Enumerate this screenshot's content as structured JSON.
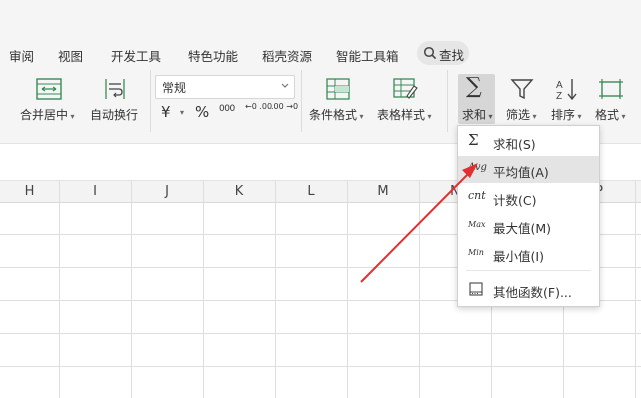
{
  "menubar": {
    "items": [
      "审阅",
      "视图",
      "开发工具",
      "特色功能",
      "稻壳资源",
      "智能工具箱"
    ],
    "search_label": "查找"
  },
  "ribbon": {
    "merge_label": "合并居中",
    "wrap_label": "自动换行",
    "number_format_value": "常规",
    "currency_symbol": "¥",
    "percent_symbol": "%",
    "thousands_symbol": "000",
    "decrease_decimal": "←0 .00",
    "increase_decimal": ".00 →0",
    "cond_format_label": "条件格式",
    "table_style_label": "表格样式",
    "sum_label": "求和",
    "filter_label": "筛选",
    "sort_label": "排序",
    "format_label": "格式"
  },
  "columns": [
    "H",
    "I",
    "J",
    "K",
    "L",
    "M",
    "N",
    "P"
  ],
  "dropdown": {
    "items": [
      {
        "icon": "Σ",
        "label": "求和(S)"
      },
      {
        "icon": "Avg",
        "label": "平均值(A)"
      },
      {
        "icon": "cnt",
        "label": "计数(C)"
      },
      {
        "icon": "Max",
        "label": "最大值(M)"
      },
      {
        "icon": "Min",
        "label": "最小值(I)"
      },
      {
        "icon": "fx",
        "label": "其他函数(F)..."
      }
    ],
    "active_index": 1
  },
  "colors": {
    "annotation_arrow": "#e03030",
    "ribbon_bg": "#f5f5f5",
    "active_item": "#e4e4e4"
  }
}
